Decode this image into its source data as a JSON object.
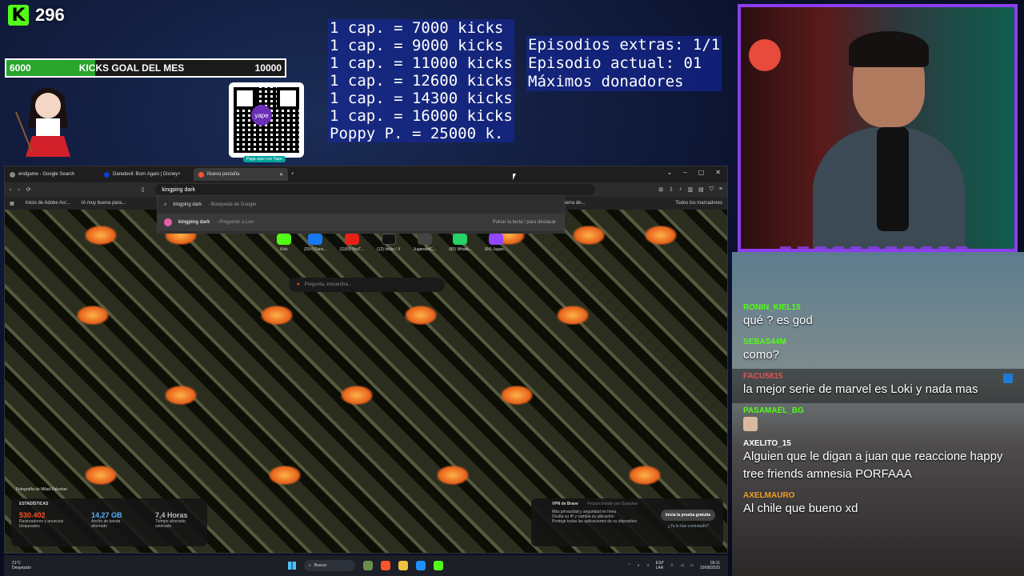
{
  "overlay": {
    "kicks_count": "296",
    "goal": {
      "min": "6000",
      "title": "KICKS GOAL DEL MES",
      "max": "10000",
      "progress_fraction": 0.32
    },
    "qr_caption": "Paga aquí con Yape",
    "qr_logo_text": "yape",
    "caps_lines": [
      "1 cap. = 7000 kicks",
      "1 cap. = 9000 kicks",
      "1 cap. = 11000 kicks",
      "1 cap. = 12600 kicks",
      "1 cap. = 14300 kicks",
      "1 cap. = 16000 kicks",
      "Poppy P. = 25000 k."
    ],
    "extras_lines": [
      "Episodios extras: 1/1",
      "Episodio actual: 01",
      "Máximos donadores"
    ]
  },
  "chat": [
    {
      "user": "RONIN_KIEL15",
      "color": "#53fc18",
      "text": "qué ? es god"
    },
    {
      "user": "SEBAS44M",
      "color": "#53fc18",
      "text": "como?"
    },
    {
      "user": "FACU5815",
      "color": "#e05555",
      "text": "la mejor serie de marvel es Loki y nada mas"
    },
    {
      "user": "PASAMAEL_BG",
      "color": "#53fc18",
      "text": ""
    },
    {
      "user": "AXELITO_15",
      "color": "#ffffff",
      "text": "Alguien que le digan a juan que reaccione happy tree friends amnesia PORFAAA"
    },
    {
      "user": "AXELMAURO",
      "color": "#f0a020",
      "text": "Al chile que bueno xd"
    }
  ],
  "browser": {
    "tabs": [
      "endgame - Google Search",
      "Daredevil: Born Again | Disney+",
      "Nueva pestaña"
    ],
    "new_tab_symbol": "+",
    "address_value": "kingping dark",
    "bookmarks": [
      "Inicio de Adobe Acr...",
      "IA muy buena para...",
      "La Guerra de...",
      "Todos los marcadores"
    ],
    "suggestions": [
      {
        "query": "kingping dark",
        "suffix": "- Búsqueda de Google",
        "hint": ""
      },
      {
        "query": "kingping dark",
        "suffix": "- Preguntar a Leo",
        "hint": "Pulsar la tecla ! para destacar"
      }
    ],
    "shortcuts": [
      "Kick",
      "(20+) Face...",
      "(1183) YouT...",
      "(12) Inicio / X",
      "JugandorC...",
      "(85) Whats...",
      "(64) Jugan..."
    ],
    "leo_placeholder": "Pregunta, encuentra...",
    "photo_credit": "Fotografía de Milad Fakurian",
    "stats": {
      "title": "ESTADÍSTICAS",
      "items": [
        {
          "value": "530.402",
          "label": "Rastreadores y anuncios bloqueados"
        },
        {
          "value": "14,27 GB",
          "label": "Ancho de banda ahorrado"
        },
        {
          "value": "7,4 Horas",
          "label": "Tiempo ahorrado estimado"
        }
      ]
    },
    "vpn": {
      "title": "VPN de Brave",
      "sponsor": "Proporcionado por Guardian",
      "bullets": [
        "Más privacidad y seguridad en línea",
        "Oculta su IP y cambia su ubicación",
        "Protege todas las aplicaciones de su dispositivo"
      ],
      "cta": "Inicia la prueba gratuita",
      "link": "¿Ya lo has contratado?"
    }
  },
  "taskbar": {
    "weather_temp": "21°C",
    "weather_desc": "Despejado",
    "search_placeholder": "Buscar",
    "lang": "ESP",
    "lang_sub": "LAA",
    "time": "09:11",
    "date": "19/08/2025"
  }
}
